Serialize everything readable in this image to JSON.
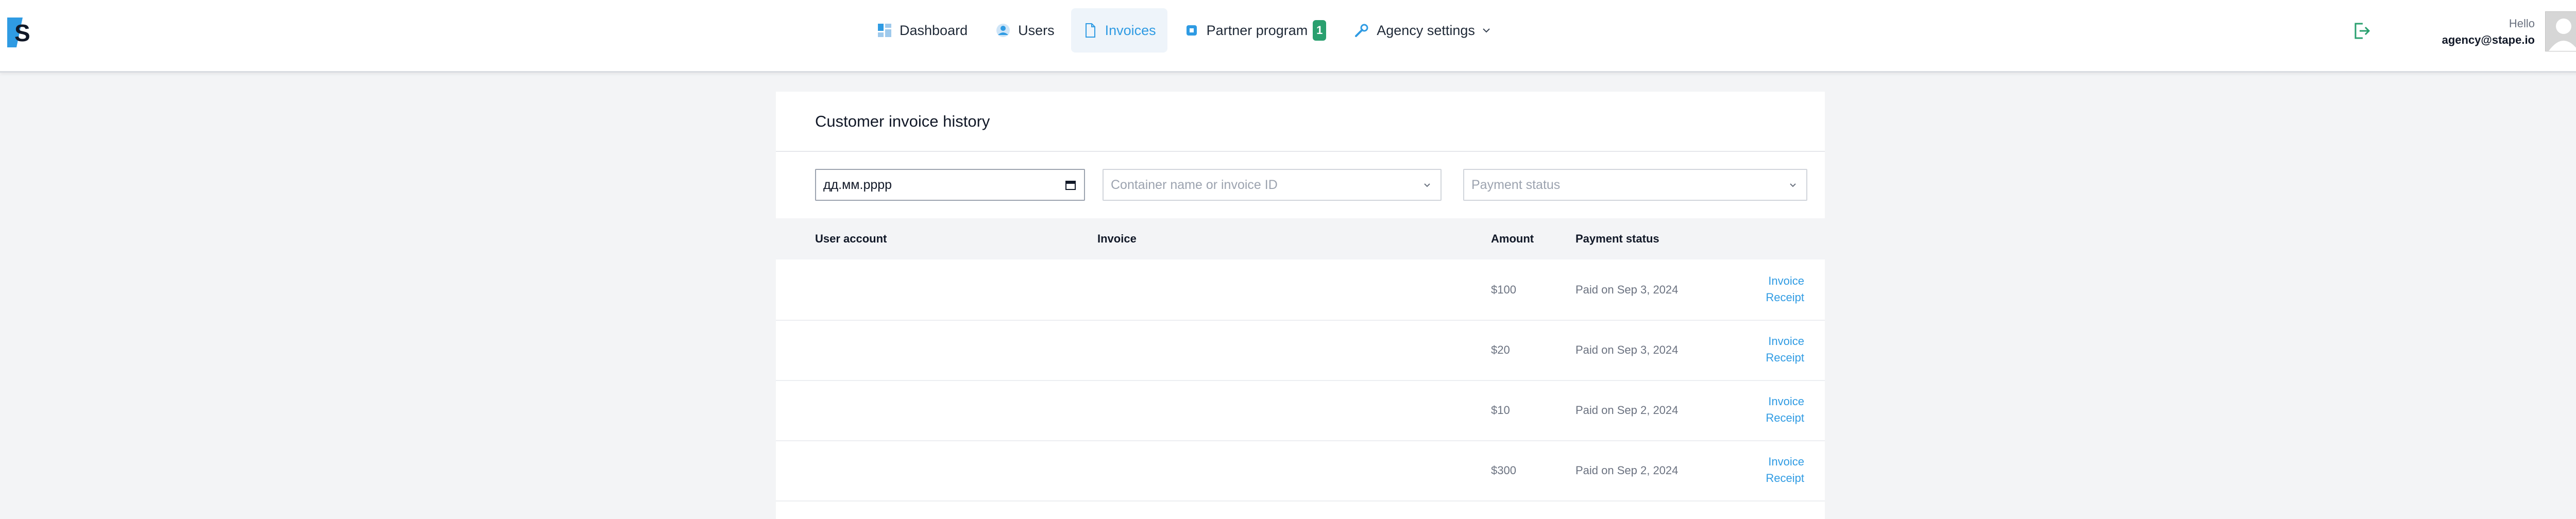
{
  "header": {
    "nav": [
      {
        "label": "Dashboard",
        "icon": "dashboard-icon"
      },
      {
        "label": "Users",
        "icon": "users-icon"
      },
      {
        "label": "Invoices",
        "icon": "invoice-document-icon",
        "active": true
      },
      {
        "label": "Partner program",
        "icon": "partner-icon",
        "badge": "1"
      },
      {
        "label": "Agency settings",
        "icon": "wrench-icon"
      }
    ],
    "greeting": "Hello",
    "email": "agency@stape.io"
  },
  "main": {
    "title": "Customer invoice history",
    "filters": {
      "date_value": "дд.мм.рррр",
      "search_placeholder": "Container name or invoice ID",
      "status_placeholder": "Payment status"
    },
    "columns": [
      "User account",
      "Invoice",
      "Amount",
      "Payment status"
    ],
    "rows": [
      {
        "amount": "$100",
        "status": "Paid on Sep 3, 2024",
        "link1": "Invoice",
        "link2": "Receipt"
      },
      {
        "amount": "$20",
        "status": "Paid on Sep 3, 2024",
        "link1": "Invoice",
        "link2": "Receipt"
      },
      {
        "amount": "$10",
        "status": "Paid on Sep 2, 2024",
        "link1": "Invoice",
        "link2": "Receipt"
      },
      {
        "amount": "$300",
        "status": "Paid on Sep 2, 2024",
        "link1": "Invoice",
        "link2": "Receipt"
      }
    ]
  },
  "colors": {
    "accent": "#2f9be3",
    "badge": "#2aa06f",
    "logout": "#2aa06f"
  }
}
